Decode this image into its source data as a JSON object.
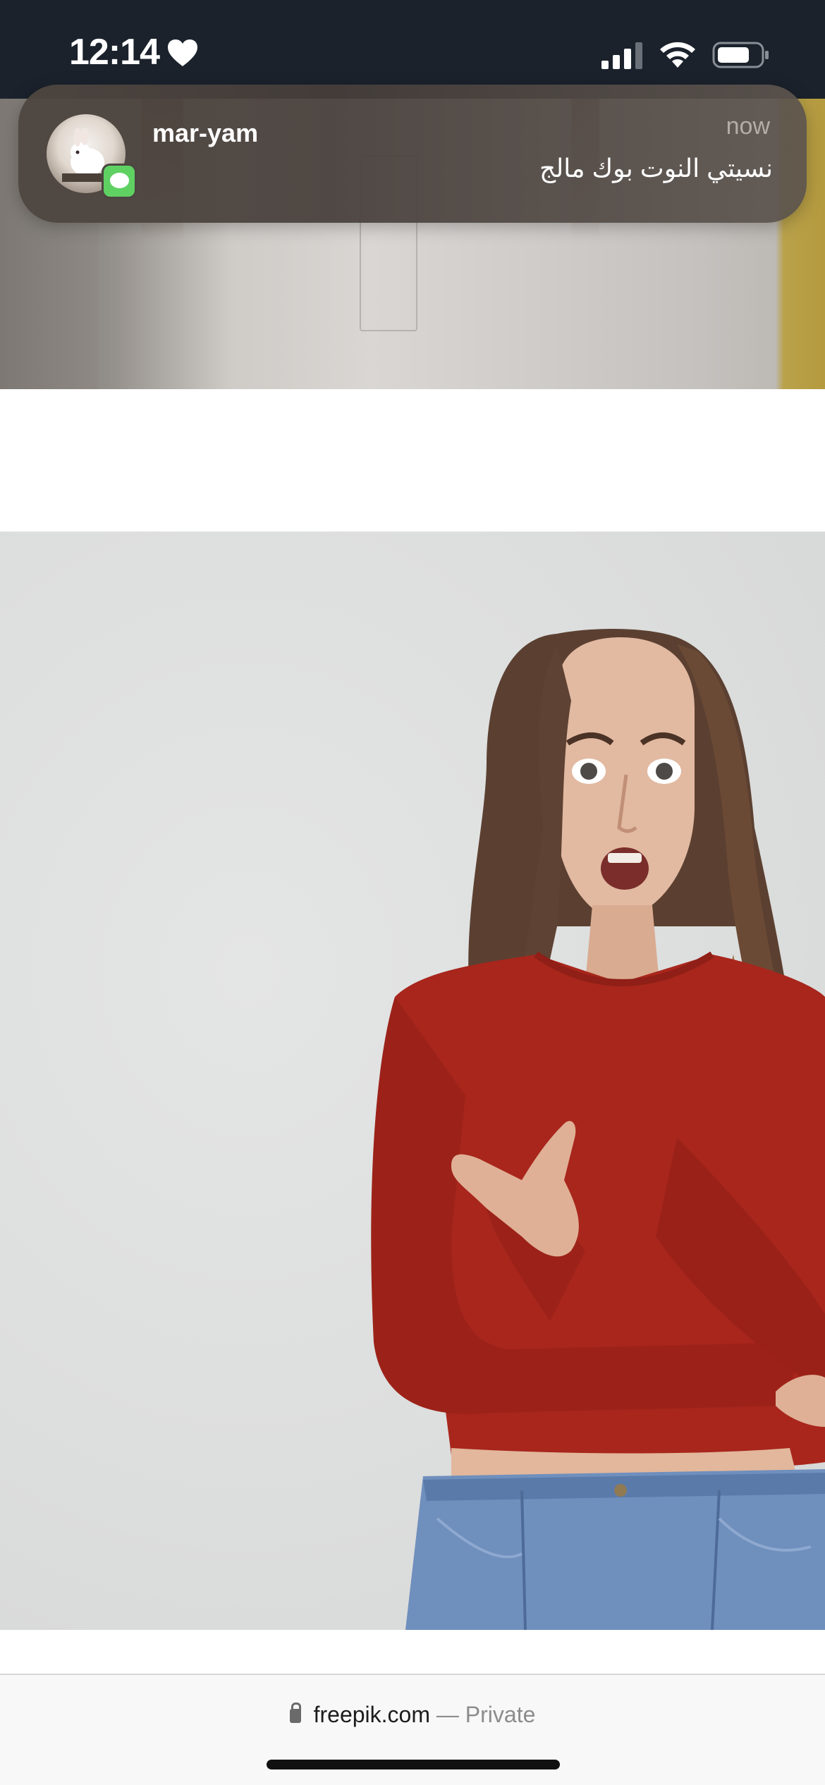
{
  "status_bar": {
    "time": "12:14",
    "focus_icon": "heart-icon",
    "icons": [
      "cellular-signal-icon",
      "wifi-icon",
      "battery-icon"
    ]
  },
  "notification": {
    "app_icon": "messages-icon",
    "sender": "mar-yam",
    "timestamp": "now",
    "message": "نسيتي النوت بوك مالج"
  },
  "browser": {
    "domain": "freepik.com",
    "mode_label": "— Private",
    "lock_icon": "lock-icon"
  },
  "colors": {
    "status_bar_bg": "#1b222c",
    "messages_green": "#5fd163",
    "sweater_red": "#a8261c",
    "jeans_blue": "#6f8fbd"
  }
}
